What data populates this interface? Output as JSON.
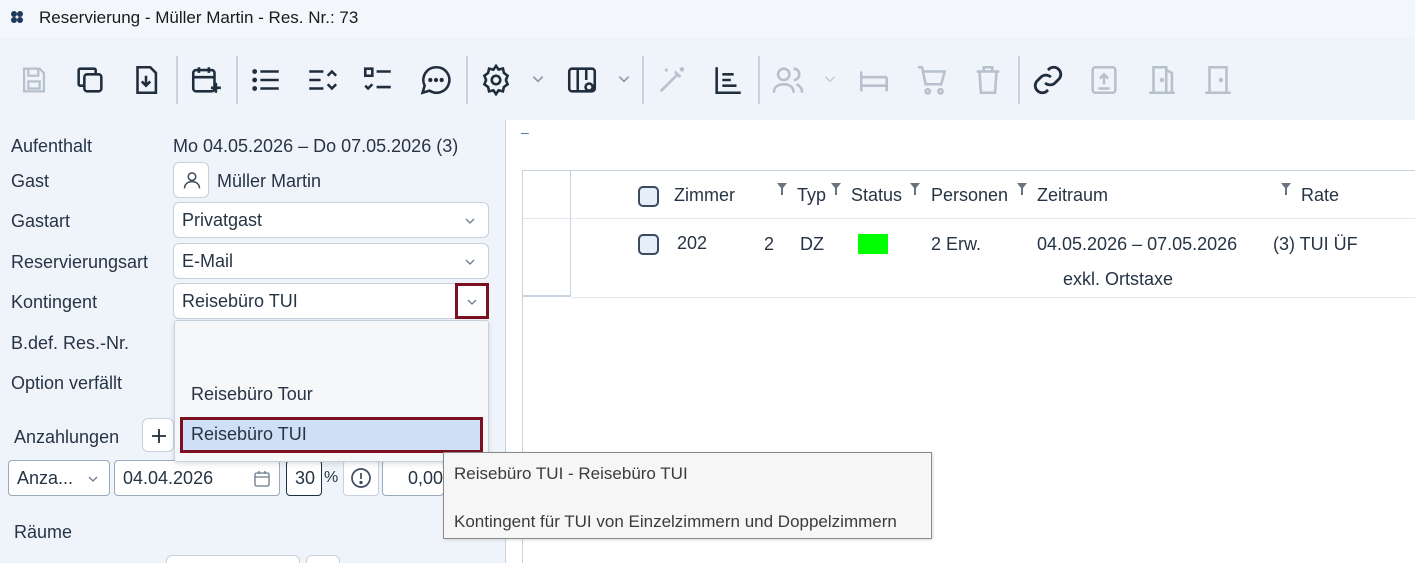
{
  "window": {
    "title": "Reservierung - Müller Martin - Res. Nr.: 73"
  },
  "toolbar": {
    "buttons": [
      {
        "name": "save-icon",
        "enabled": false
      },
      {
        "name": "copy-icon",
        "enabled": true
      },
      {
        "name": "download-icon",
        "enabled": true
      },
      {
        "name": "calendar-add-icon",
        "enabled": true
      },
      {
        "name": "list-icon",
        "enabled": true
      },
      {
        "name": "sort-list-icon",
        "enabled": true
      },
      {
        "name": "checklist-icon",
        "enabled": true
      },
      {
        "name": "chat-icon",
        "enabled": true
      },
      {
        "name": "gear-icon",
        "enabled": true
      },
      {
        "name": "layout-gear-icon",
        "enabled": true
      },
      {
        "name": "magic-wand-icon",
        "enabled": false
      },
      {
        "name": "chart-list-icon",
        "enabled": true
      },
      {
        "name": "people-icon",
        "enabled": false
      },
      {
        "name": "bed-icon",
        "enabled": false
      },
      {
        "name": "cart-icon",
        "enabled": false
      },
      {
        "name": "trash-icon",
        "enabled": false
      },
      {
        "name": "link-icon",
        "enabled": true
      },
      {
        "name": "upload-icon",
        "enabled": false
      },
      {
        "name": "door-open-icon",
        "enabled": false
      },
      {
        "name": "door-icon",
        "enabled": false
      }
    ]
  },
  "form": {
    "stay": {
      "label": "Aufenthalt",
      "value": "Mo 04.05.2026 – Do 07.05.2026 (3)"
    },
    "guest": {
      "label": "Gast",
      "value": "Müller Martin"
    },
    "guest_type": {
      "label": "Gastart",
      "value": "Privatgast"
    },
    "reservation_type": {
      "label": "Reservierungsart",
      "value": "E-Mail"
    },
    "contingent": {
      "label": "Kontingent",
      "value": "Reisebüro TUI"
    },
    "ref_number": {
      "label": "B.def. Res.-Nr."
    },
    "option_expires": {
      "label": "Option verfällt"
    },
    "deposits": {
      "label": "Anzahlungen",
      "type_value": "Anza...",
      "date_value": "04.04.2026",
      "percent_value": "30",
      "percent_symbol": "%",
      "amount_value": "0,00"
    },
    "rooms": {
      "label": "Räume"
    }
  },
  "dropdown": {
    "options": [
      "",
      "Reisebüro Tour",
      "Reisebüro TUI"
    ],
    "selected": "Reisebüro TUI"
  },
  "tooltip": {
    "line1": "Reisebüro TUI - Reisebüro TUI",
    "line2": "Kontingent für TUI von Einzelzimmern und Doppelzimmern"
  },
  "grid": {
    "top_marker": "–",
    "columns": [
      "Zimmer",
      "Typ",
      "Status",
      "Personen",
      "Zeitraum",
      "Rate"
    ],
    "rows": [
      {
        "room": "202",
        "count": "2",
        "type": "DZ",
        "status_color": "#00ff00",
        "persons": "2 Erw.",
        "period": "04.05.2026 – 07.05.2026",
        "period_note": "exkl. Ortstaxe",
        "rate": "(3) TUI ÜF"
      }
    ]
  },
  "colors": {
    "accent_border": "#7b1020",
    "selected_bg": "#cfe0f6",
    "pane_bg": "#eff4fa"
  }
}
